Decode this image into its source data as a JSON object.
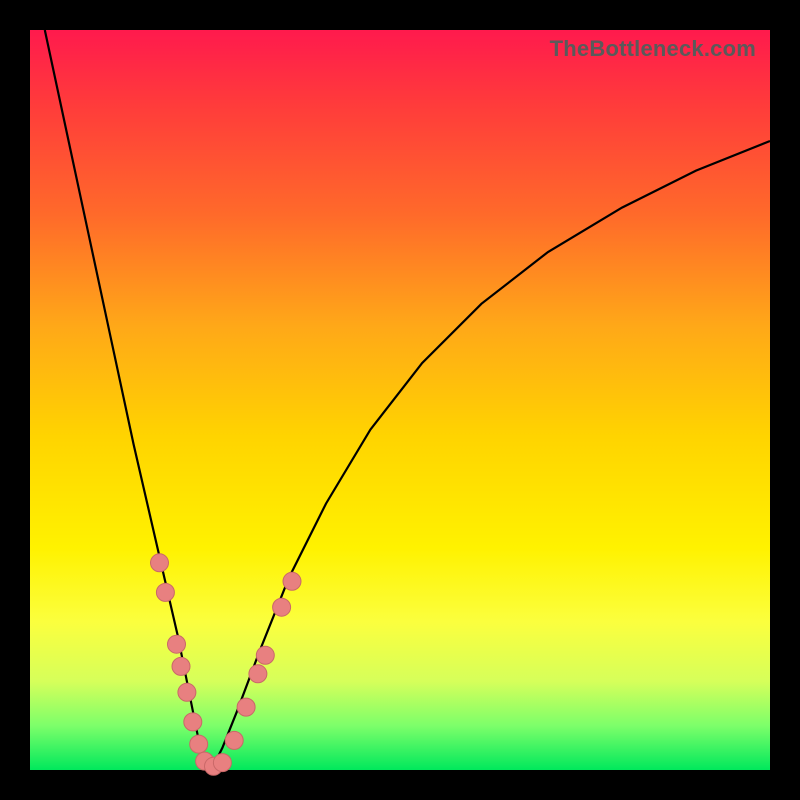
{
  "watermark": "TheBottleneck.com",
  "colors": {
    "dot_fill": "#e88080",
    "dot_stroke": "#c96868",
    "curve": "#000000",
    "frame": "#000000"
  },
  "chart_data": {
    "type": "line",
    "title": "",
    "xlabel": "",
    "ylabel": "",
    "xlim": [
      0,
      100
    ],
    "ylim": [
      0,
      100
    ],
    "grid": false,
    "description": "V-shaped bottleneck curve showing mismatch percentage; minimum (zero) around x≈24, rising asymmetrically on both sides over a red-to-green vertical gradient background.",
    "series": [
      {
        "name": "bottleneck-curve",
        "x": [
          2,
          5,
          8,
          11,
          14,
          17,
          20,
          22,
          23,
          24,
          25,
          26,
          28,
          31,
          35,
          40,
          46,
          53,
          61,
          70,
          80,
          90,
          100
        ],
        "y": [
          100,
          86,
          72,
          58,
          44,
          31,
          18,
          8,
          3,
          0,
          1,
          3,
          8,
          16,
          26,
          36,
          46,
          55,
          63,
          70,
          76,
          81,
          85
        ]
      }
    ],
    "markers": [
      {
        "x": 17.5,
        "y": 28
      },
      {
        "x": 18.3,
        "y": 24
      },
      {
        "x": 19.8,
        "y": 17
      },
      {
        "x": 20.4,
        "y": 14
      },
      {
        "x": 21.2,
        "y": 10.5
      },
      {
        "x": 22.0,
        "y": 6.5
      },
      {
        "x": 22.8,
        "y": 3.5
      },
      {
        "x": 23.6,
        "y": 1.2
      },
      {
        "x": 24.8,
        "y": 0.5
      },
      {
        "x": 26.0,
        "y": 1.0
      },
      {
        "x": 27.6,
        "y": 4.0
      },
      {
        "x": 29.2,
        "y": 8.5
      },
      {
        "x": 30.8,
        "y": 13.0
      },
      {
        "x": 31.8,
        "y": 15.5
      },
      {
        "x": 34.0,
        "y": 22.0
      },
      {
        "x": 35.4,
        "y": 25.5
      }
    ]
  }
}
